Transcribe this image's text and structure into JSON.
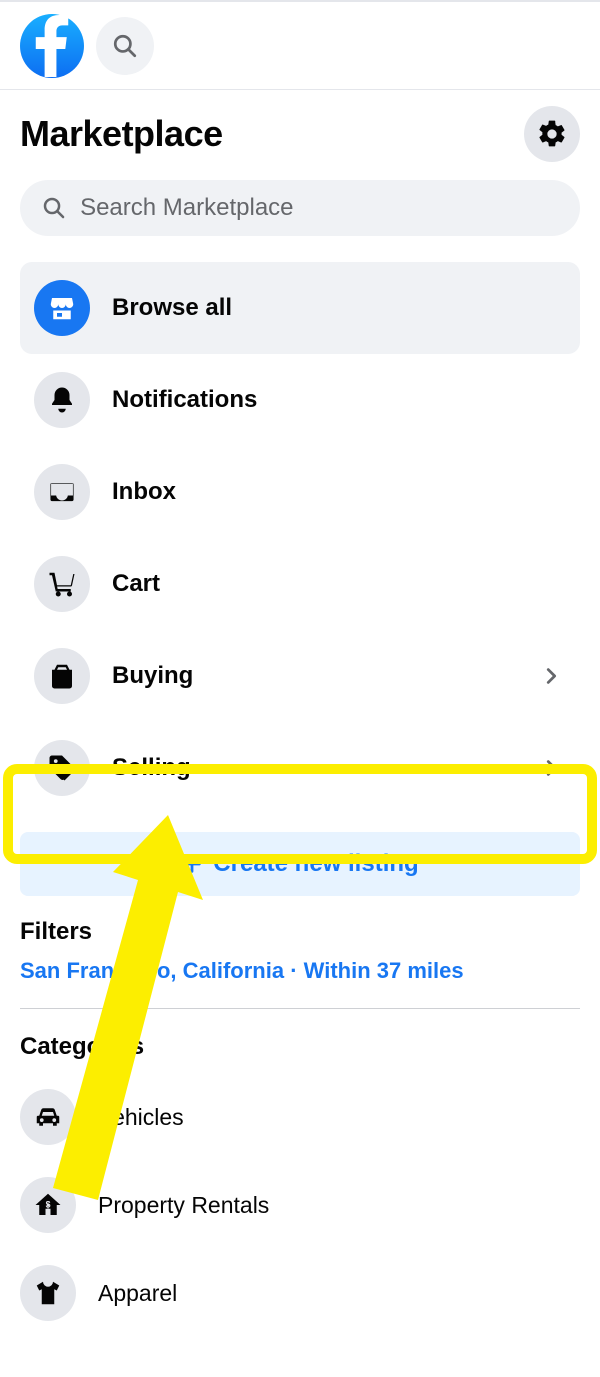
{
  "header": {
    "title": "Marketplace"
  },
  "search": {
    "placeholder": "Search Marketplace"
  },
  "nav": {
    "browse": "Browse all",
    "notifications": "Notifications",
    "inbox": "Inbox",
    "cart": "Cart",
    "buying": "Buying",
    "selling": "Selling"
  },
  "create_listing": "Create new listing",
  "filters": {
    "heading": "Filters",
    "location": "San Francisco, California",
    "separator": " · ",
    "radius": "Within 37 miles"
  },
  "categories": {
    "heading": "Categories",
    "items": [
      "Vehicles",
      "Property Rentals",
      "Apparel"
    ]
  }
}
